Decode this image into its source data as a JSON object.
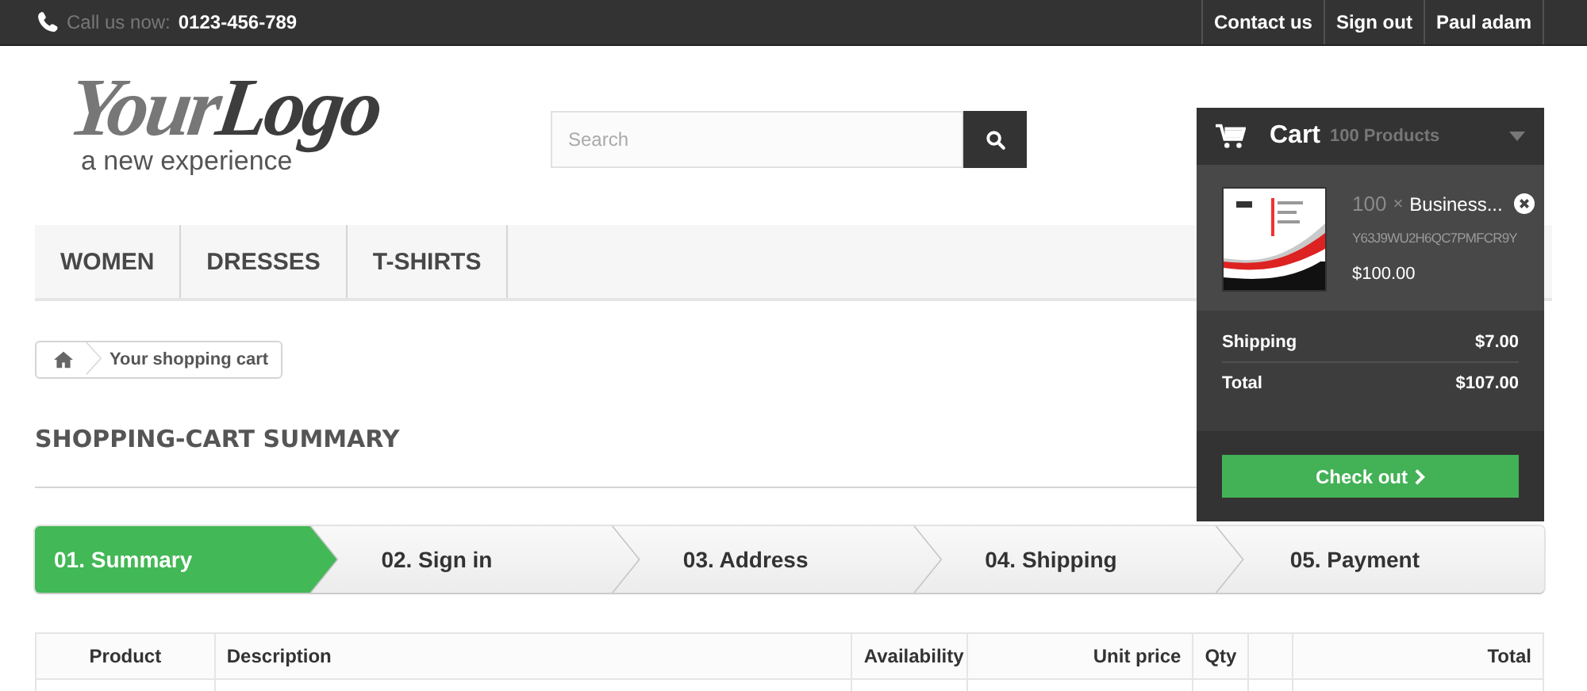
{
  "top_bar": {
    "call_label": "Call us now:",
    "phone": "0123-456-789",
    "links": [
      "Contact us",
      "Sign out",
      "Paul adam"
    ]
  },
  "logo": {
    "wordmark": [
      "Your",
      "Logo"
    ],
    "tagline": "a new experience"
  },
  "search": {
    "placeholder": "Search"
  },
  "menu": [
    "WOMEN",
    "DRESSES",
    "T-SHIRTS"
  ],
  "cart": {
    "title": "Cart",
    "count": "100 Products",
    "item": {
      "kind": "picture",
      "qty": "100",
      "times": "×",
      "name": "Business...",
      "reference": "Y63J9WU2H6QC7PMFCR9Y",
      "price": "$100.00"
    },
    "totals": [
      {
        "label": "Shipping",
        "value": "$7.00"
      },
      {
        "label": "Total",
        "value": "$107.00"
      }
    ],
    "checkout": "Check out"
  },
  "breadcrumb": {
    "current": "Your shopping cart"
  },
  "heading": "SHOPPING-CART SUMMARY",
  "steps": [
    {
      "label": "01. Summary",
      "selected": true
    },
    {
      "label": "02. Sign in",
      "selected": false
    },
    {
      "label": "03. Address",
      "selected": false
    },
    {
      "label": "04. Shipping",
      "selected": false
    },
    {
      "label": "05. Payment",
      "selected": false
    }
  ],
  "table": {
    "columns": [
      {
        "kind": "text",
        "label": "Product"
      },
      {
        "kind": "text",
        "label": "Description"
      },
      {
        "kind": "text",
        "label": "Availability"
      },
      {
        "kind": "text",
        "label": "Unit price"
      },
      {
        "kind": "text",
        "label": "Qty"
      },
      {
        "kind": "empty"
      },
      {
        "kind": "text",
        "label": "Total"
      }
    ]
  }
}
